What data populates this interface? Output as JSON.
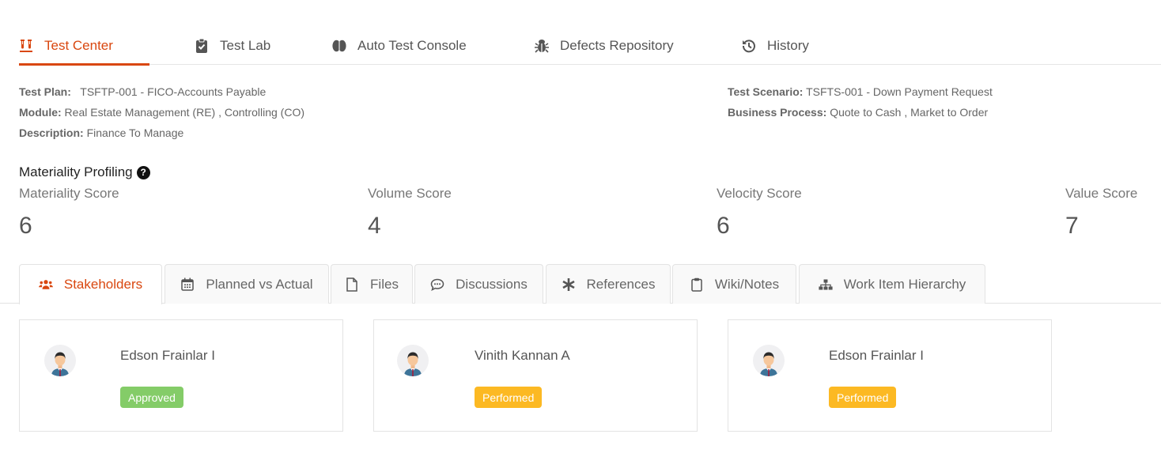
{
  "topnav": {
    "items": [
      {
        "label": "Test Center",
        "icon": "test-tubes-icon",
        "active": true
      },
      {
        "label": "Test Lab",
        "icon": "clipboard-check-icon",
        "active": false
      },
      {
        "label": "Auto Test Console",
        "icon": "brain-icon",
        "active": false
      },
      {
        "label": "Defects Repository",
        "icon": "bug-icon",
        "active": false
      },
      {
        "label": "History",
        "icon": "history-icon",
        "active": false
      }
    ]
  },
  "info": {
    "test_plan_label": "Test Plan:",
    "test_plan_value": "TSFTP-001 - FICO-Accounts Payable",
    "module_label": "Module:",
    "module_value": "Real Estate Management (RE) , Controlling (CO)",
    "description_label": "Description:",
    "description_value": "Finance To Manage",
    "test_scenario_label": "Test Scenario:",
    "test_scenario_value": "TSFTS-001 - Down Payment Request",
    "business_process_label": "Business Process:",
    "business_process_value": "Quote to Cash , Market to Order"
  },
  "materiality": {
    "title": "Materiality Profiling",
    "help_icon": "?",
    "scores": [
      {
        "label": "Materiality Score",
        "value": "6"
      },
      {
        "label": "Volume Score",
        "value": "4"
      },
      {
        "label": "Velocity Score",
        "value": "6"
      },
      {
        "label": "Value Score",
        "value": "7"
      }
    ]
  },
  "tabs": [
    {
      "label": "Stakeholders",
      "icon": "users-icon",
      "active": true
    },
    {
      "label": "Planned vs Actual",
      "icon": "calendar-icon",
      "active": false
    },
    {
      "label": "Files",
      "icon": "file-icon",
      "active": false
    },
    {
      "label": "Discussions",
      "icon": "comment-icon",
      "active": false
    },
    {
      "label": "References",
      "icon": "asterisk-icon",
      "active": false
    },
    {
      "label": "Wiki/Notes",
      "icon": "clipboard-icon",
      "active": false
    },
    {
      "label": "Work Item Hierarchy",
      "icon": "sitemap-icon",
      "active": false
    }
  ],
  "stakeholders": [
    {
      "name": "Edson Frainlar I",
      "status": "Approved",
      "status_color": "#84cc68"
    },
    {
      "name": "Vinith Kannan A",
      "status": "Performed",
      "status_color": "#fcb923"
    },
    {
      "name": "Edson Frainlar I",
      "status": "Performed",
      "status_color": "#fcb923"
    }
  ],
  "colors": {
    "accent": "#d9470f",
    "approved": "#84cc68",
    "performed": "#fcb923"
  }
}
